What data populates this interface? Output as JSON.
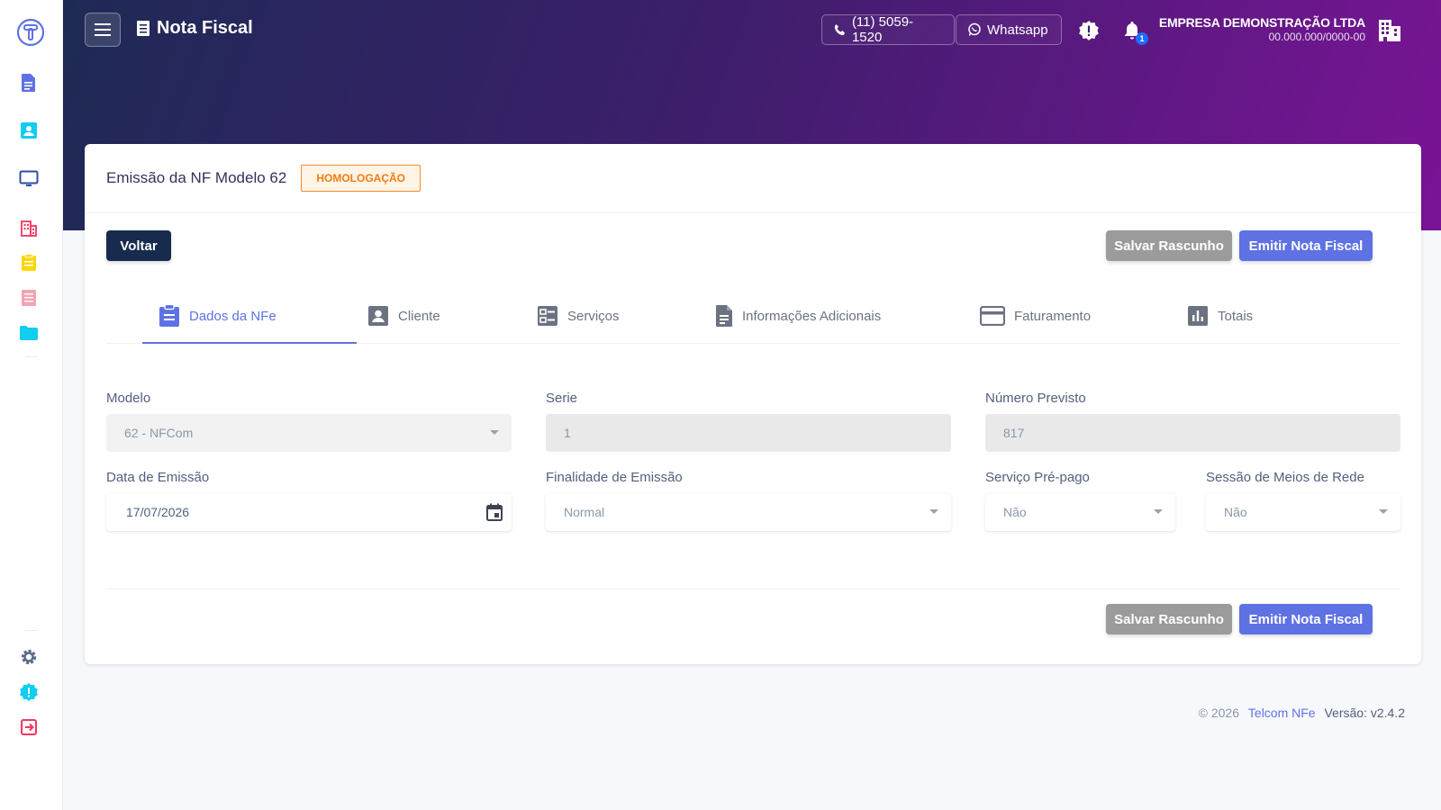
{
  "app": {
    "title": "Nota Fiscal"
  },
  "header": {
    "phone": "(11) 5059-1520",
    "whatsapp": "Whatsapp",
    "notifications_count": "1",
    "company_name": "EMPRESA DEMONSTRAÇÃO LTDA",
    "company_cnpj": "00.000.000/0000-00"
  },
  "card": {
    "title": "Emissão da NF Modelo 62",
    "env_badge": "HOMOLOGAÇÃO",
    "back_label": "Voltar",
    "save_draft_label": "Salvar Rascunho",
    "emit_label": "Emitir Nota Fiscal"
  },
  "tabs": [
    {
      "label": "Dados da NFe",
      "icon": "clipboard-icon",
      "active": true
    },
    {
      "label": "Cliente",
      "icon": "contact-icon"
    },
    {
      "label": "Serviços",
      "icon": "checklist-icon"
    },
    {
      "label": "Informações Adicionais",
      "icon": "document-icon"
    },
    {
      "label": "Faturamento",
      "icon": "credit-card-icon"
    },
    {
      "label": "Totais",
      "icon": "bar-chart-icon"
    }
  ],
  "form": {
    "modelo": {
      "label": "Modelo",
      "value": "62 - NFCom"
    },
    "serie": {
      "label": "Serie",
      "value": "1"
    },
    "numero": {
      "label": "Número Previsto",
      "value": "817"
    },
    "data_emissao": {
      "label": "Data de Emissão",
      "value": "17/07/2026"
    },
    "finalidade": {
      "label": "Finalidade de Emissão",
      "value": "Normal"
    },
    "pre_pago": {
      "label": "Serviço Pré-pago",
      "value": "Não"
    },
    "sessao": {
      "label": "Sessão de Meios de Rede",
      "value": "Não"
    }
  },
  "footer": {
    "copyright": "© 2026",
    "brand": "Telcom NFe",
    "version": "Versão: v2.4.2"
  },
  "colors": {
    "primary": "#5e72e4",
    "dark": "#172b4d",
    "warning": "#f07d12",
    "gray_button": "#9b9b9b"
  }
}
